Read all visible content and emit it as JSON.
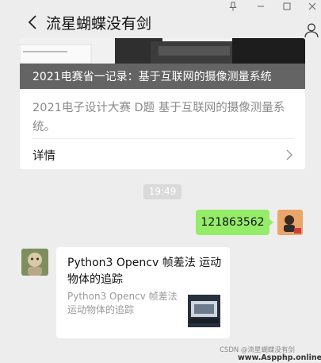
{
  "header": {
    "title": "流星蝴蝶没有剑"
  },
  "article": {
    "banner_title": "2021电赛省一记录：基于互联网的摄像测量系统",
    "description": "2021电子设计大赛 D题 基于互联网的摄像测量系统。",
    "detail_label": "详情"
  },
  "chat": {
    "timestamp": "19:49",
    "sent_message": "121863562",
    "link_card": {
      "title": "Python3 Opencv 帧差法 运动物体的追踪",
      "description": "Python3 Opencv 帧差法 运动物体的追踪"
    }
  },
  "watermark": {
    "csdn": "CSDN @流星蝴蝶没有剑",
    "site": "www.Aspphp.online"
  },
  "colors": {
    "background": "#ededed",
    "sent_bubble": "#95ec69",
    "card": "#ffffff"
  }
}
